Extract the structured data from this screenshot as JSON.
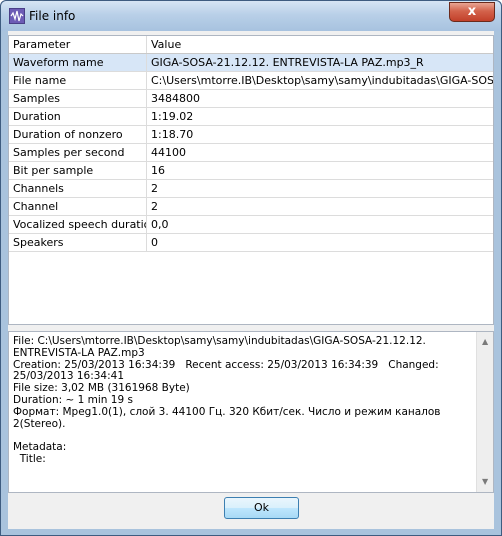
{
  "window": {
    "title": "File info",
    "close_label": "x",
    "accent": "#a9c3dd"
  },
  "table": {
    "headers": [
      "Parameter",
      "Value"
    ],
    "rows": [
      {
        "param": "Waveform name",
        "value": "GIGA-SOSA-21.12.12. ENTREVISTA-LA PAZ.mp3_R"
      },
      {
        "param": "File name",
        "value": "C:\\Users\\mtorre.IB\\Desktop\\samy\\samy\\indubitadas\\GIGA-SOSA-21.12."
      },
      {
        "param": "Samples",
        "value": "3484800"
      },
      {
        "param": "Duration",
        "value": "1:19.02"
      },
      {
        "param": "Duration of nonzero",
        "value": "1:18.70"
      },
      {
        "param": "Samples per second",
        "value": "44100"
      },
      {
        "param": "Bit per sample",
        "value": "16"
      },
      {
        "param": "Channels",
        "value": "2"
      },
      {
        "param": "Channel",
        "value": "2"
      },
      {
        "param": "Vocalized speech duration, s",
        "value": "0,0"
      },
      {
        "param": "Speakers",
        "value": "0"
      }
    ]
  },
  "details": {
    "text": "File: C:\\Users\\mtorre.IB\\Desktop\\samy\\samy\\indubitadas\\GIGA-SOSA-21.12.12. ENTREVISTA-LA PAZ.mp3\nCreation: 25/03/2013 16:34:39   Recent access: 25/03/2013 16:34:39   Changed: 25/03/2013 16:34:41\nFile size: 3,02 MB (3161968 Byte)\nDuration: ~ 1 min 19 s\nФормат: Mpeg1.0(1), слой 3. 44100 Гц. 320 Кбит/сек. Число и режим каналов 2(Stereo).\n\nMetadata:\n  Title:"
  },
  "buttons": {
    "ok": "Ok"
  }
}
